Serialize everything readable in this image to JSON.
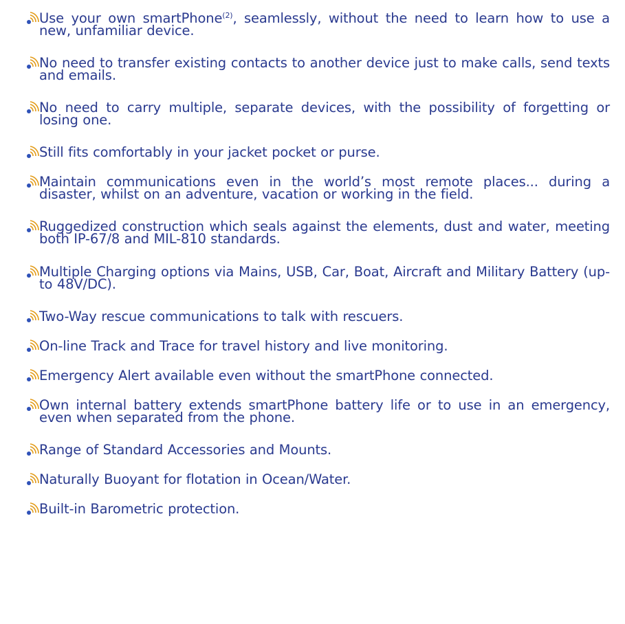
{
  "features": [
    {
      "text": "Use your own smartPhone",
      "sup": "(2)",
      "after": ", seamlessly, without the need to learn how to use a new, unfamiliar device."
    },
    {
      "text": "No need to transfer existing contacts to another device just to make calls, send texts and emails."
    },
    {
      "text": "No need to carry multiple, separate devices, with the possibility of forgetting or losing one."
    },
    {
      "text": "Still fits comfortably in your jacket pocket or purse."
    },
    {
      "text": "Maintain communications even in the world’s most remote places... during a disaster, whilst on an adventure, vacation or working in the field."
    },
    {
      "text": "Ruggedized construction which seals against the elements, dust and water, meeting both IP-67/8 and MIL-810 standards."
    },
    {
      "text": "Multiple Charging options via Mains, USB, Car, Boat, Aircraft and Military Battery (up-to 48V/DC)."
    },
    {
      "text": "Two-Way rescue communications to talk with rescuers."
    },
    {
      "text": "On-line Track and Trace for travel history and live monitoring."
    },
    {
      "text": "Emergency Alert available even without the smartPhone connected."
    },
    {
      "text": "Own internal battery extends smartPhone battery life or to use in an emergency, even when separated from the phone."
    },
    {
      "text": "Range of Standard Accessories and Mounts."
    },
    {
      "text": "Naturally Buoyant for flotation in Ocean/Water."
    },
    {
      "text": "Built-in Barometric protection."
    }
  ],
  "colors": {
    "text": "#2a3a8f",
    "icon_dot": "#2f52b8",
    "icon_waves": "#e29a16"
  },
  "icon_name": "signal-waves-icon"
}
